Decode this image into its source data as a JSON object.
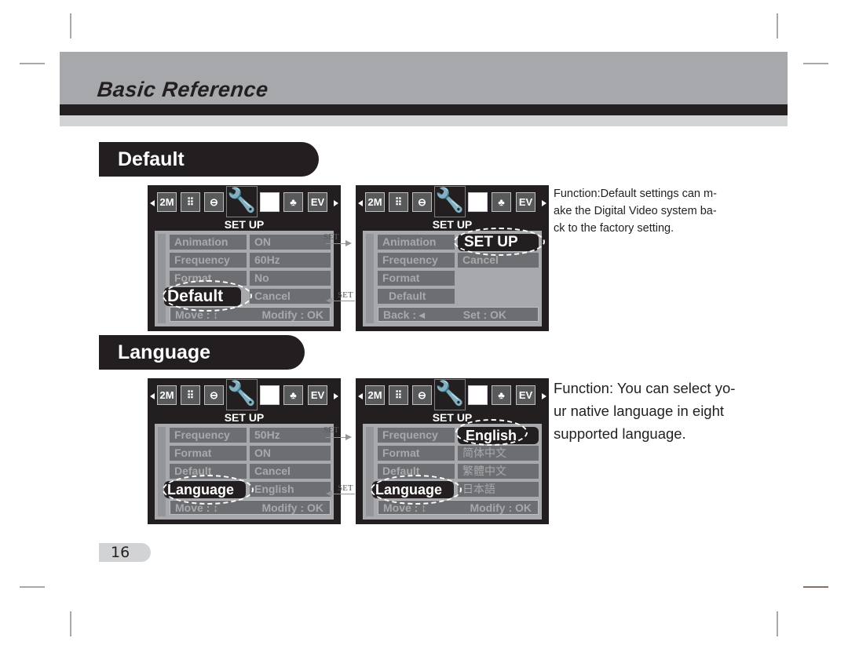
{
  "header": {
    "title": "Basic Reference"
  },
  "sections": {
    "default": {
      "heading": "Default",
      "description_lines": [
        "Function:Default settings can m-",
        "ake the Digital Video system ba-",
        "ck to the factory setting."
      ],
      "screen_left": {
        "title": "SET UP",
        "icons": [
          "2M",
          "grid-icon",
          "scene-icon",
          "wrench-icon",
          "white-balance-icon",
          "light-icon",
          "EV"
        ],
        "rows": [
          {
            "label": "Animation",
            "value": "ON"
          },
          {
            "label": "Frequency",
            "value": "60Hz"
          },
          {
            "label": "Format",
            "value": "No"
          },
          {
            "label": "Default",
            "value": "Cancel"
          }
        ],
        "highlighted": "Default",
        "footer_left": "Move : ↕",
        "footer_right": "Modify : OK"
      },
      "screen_right": {
        "title": "SET UP",
        "icons": [
          "2M",
          "grid-icon",
          "scene-icon",
          "wrench-icon",
          "white-balance-icon",
          "light-icon",
          "EV"
        ],
        "rows": [
          {
            "label": "Animation",
            "value": "SET UP"
          },
          {
            "label": "Frequency",
            "value": "Cancel"
          },
          {
            "label": "Format",
            "value": ""
          },
          {
            "label": "Default",
            "value": ""
          }
        ],
        "highlighted": "SET UP",
        "footer_left": "Back : ◂",
        "footer_right": "Set : OK"
      },
      "connector_top_label": "SET",
      "connector_bottom_label": "SET"
    },
    "language": {
      "heading": "Language",
      "description_lines": [
        "Function: You can select yo-",
        "ur native language in eight",
        "supported language."
      ],
      "screen_left": {
        "title": "SET UP",
        "icons": [
          "2M",
          "grid-icon",
          "scene-icon",
          "wrench-icon",
          "white-balance-icon",
          "light-icon",
          "EV"
        ],
        "rows": [
          {
            "label": "Frequency",
            "value": "50Hz"
          },
          {
            "label": "Format",
            "value": "ON"
          },
          {
            "label": "Default",
            "value": "Cancel"
          },
          {
            "label": "Language",
            "value": "English"
          }
        ],
        "highlighted": "Language",
        "footer_left": "Move : ↕",
        "footer_right": "Modify : OK"
      },
      "screen_right": {
        "title": "SET UP",
        "icons": [
          "2M",
          "grid-icon",
          "scene-icon",
          "wrench-icon",
          "white-balance-icon",
          "light-icon",
          "EV"
        ],
        "rows": [
          {
            "label": "Frequency",
            "value": "English"
          },
          {
            "label": "Format",
            "value": "简体中文"
          },
          {
            "label": "Default",
            "value": "繁體中文"
          },
          {
            "label": "Language",
            "value": "日本語"
          }
        ],
        "highlighted": "English",
        "footer_left": "Move : ↕",
        "footer_right": "Modify : OK"
      },
      "connector_top_label": "SET",
      "connector_bottom_label": "SET"
    }
  },
  "page_number": "16"
}
